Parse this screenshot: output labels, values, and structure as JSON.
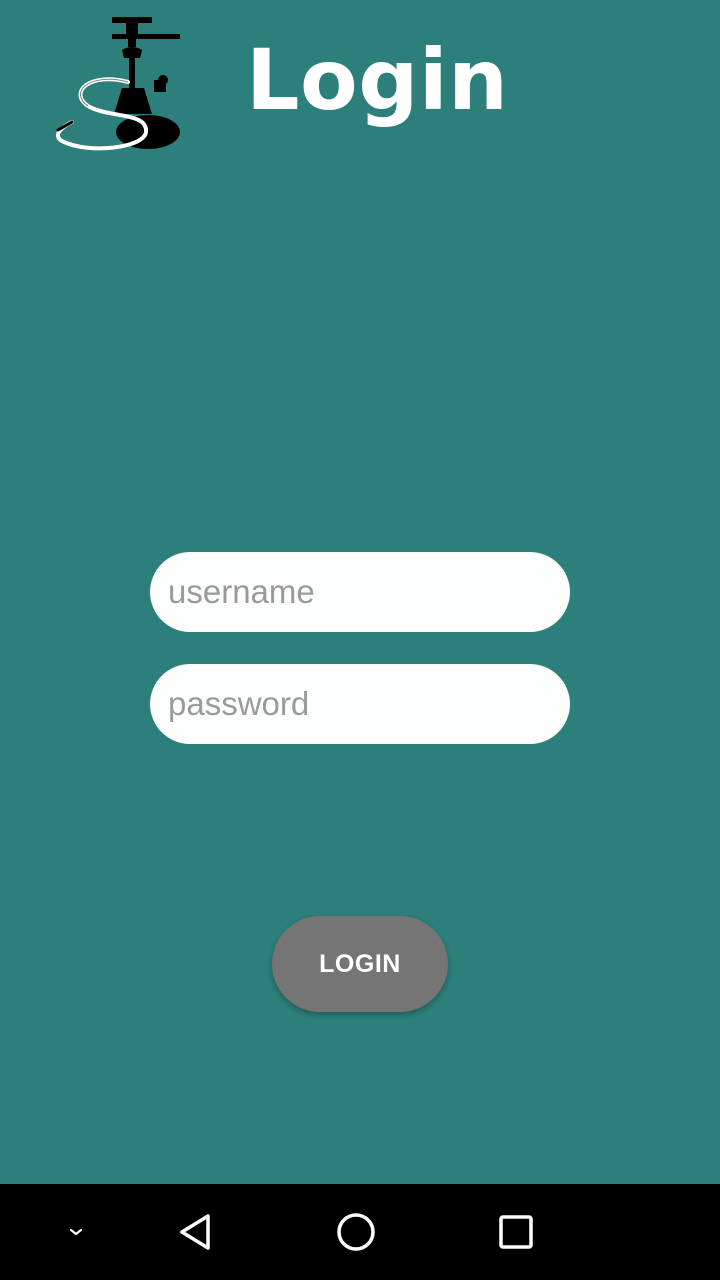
{
  "colors": {
    "background": "#2c7f7b",
    "field_background": "#fcfdfd",
    "button_background": "#757575",
    "navbar": "#000000",
    "text_light": "#ffffff"
  },
  "header": {
    "logo_icon": "hookah-logo-icon",
    "title": "Login"
  },
  "form": {
    "username_placeholder": "username",
    "password_placeholder": "password",
    "login_label": "LOGIN"
  },
  "navbar": {
    "items": [
      {
        "icon": "chevron-down-icon"
      },
      {
        "icon": "back-triangle-icon"
      },
      {
        "icon": "home-circle-icon"
      },
      {
        "icon": "recents-square-icon"
      }
    ]
  }
}
